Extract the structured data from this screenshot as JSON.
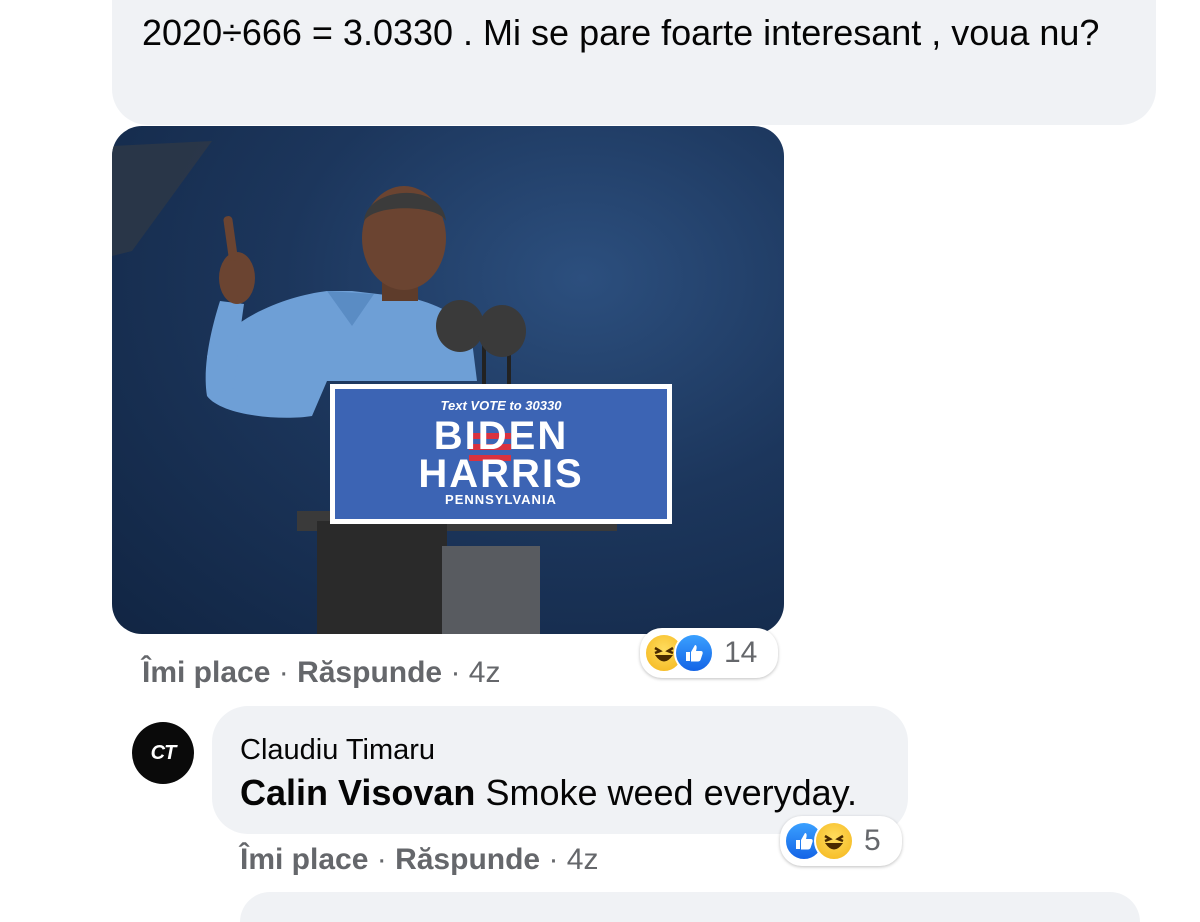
{
  "comment": {
    "text": "2020÷666 = 3.0330 . Mi se pare foarte interesant , voua nu?",
    "photo": {
      "podium_top": "Text VOTE to 30330",
      "podium_line1": "BIDEN",
      "podium_line2": "HARRIS",
      "podium_line3": "PENNSYLVANIA"
    },
    "reactions": {
      "icons": [
        "haha-icon",
        "like-icon"
      ],
      "count": "14"
    },
    "actions": {
      "like": "Îmi place",
      "reply": "Răspunde",
      "sep": "·",
      "time": "4z"
    }
  },
  "reply": {
    "avatar_initials": "CT",
    "author": "Claudiu Timaru",
    "mention": "Calin Visovan",
    "text": "Smoke weed everyday.",
    "reactions": {
      "icons": [
        "like-icon",
        "haha-icon"
      ],
      "count": "5"
    },
    "actions": {
      "like": "Îmi place",
      "reply": "Răspunde",
      "sep": "·",
      "time": "4z"
    }
  },
  "colors": {
    "bubble": "#f0f2f5",
    "meta_text": "#65676b",
    "like_blue": "#1877f2",
    "haha_yellow": "#f7b928",
    "podium_blue": "#3c64b4"
  }
}
